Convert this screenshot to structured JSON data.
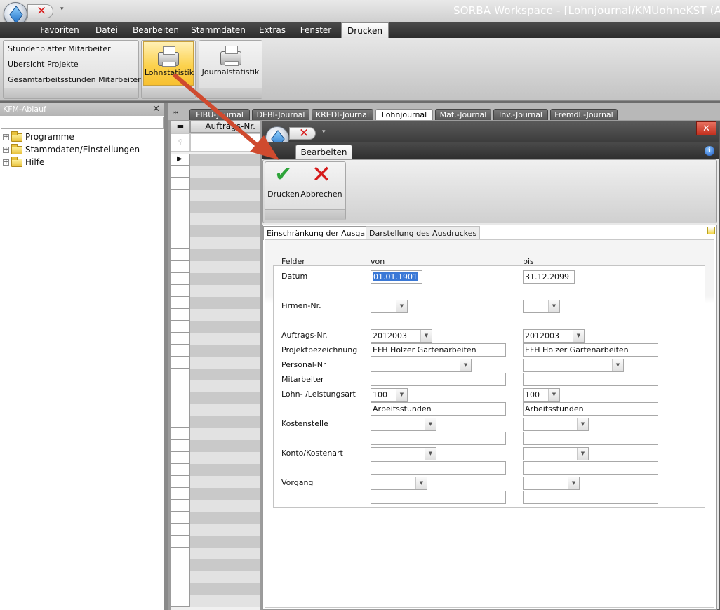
{
  "app": {
    "title": "SORBA Workspace - [Lohnjournal/KMUohneKST (Arbeits"
  },
  "menu": [
    "Favoriten",
    "Datei",
    "Bearbeiten",
    "Stammdaten",
    "Extras",
    "Fenster",
    "Drucken"
  ],
  "ribbon": {
    "links": [
      "Stundenblätter Mitarbeiter",
      "Übersicht Projekte",
      "Gesamtarbeitsstunden Mitarbeiter"
    ],
    "lohnstatistik_label": "Lohnstatistik",
    "journalstatistik_label": "Journalstatistik"
  },
  "left_panel": {
    "title": "KFM-Ablauf",
    "tree": [
      "Programme",
      "Stammdaten/Einstellungen",
      "Hilfe"
    ]
  },
  "journal_tabs": [
    "FIBU-Journal",
    "DEBI-Journal",
    "KREDI-Journal",
    "Lohnjournal",
    "Mat.-Journal",
    "Inv.-Journal",
    "Fremdl.-Journal"
  ],
  "grid": {
    "column_header": "Auftrags-Nr."
  },
  "dialog": {
    "tab": "Bearbeiten",
    "actions": {
      "print": "Drucken",
      "cancel": "Abbrechen"
    },
    "content_tabs": [
      "Einschränkung der Ausgabe",
      "Darstellung des Ausdruckes"
    ],
    "headers": {
      "felder": "Felder",
      "von": "von",
      "bis": "bis"
    },
    "fields": {
      "datum": {
        "label": "Datum",
        "von": "01.01.1901",
        "bis": "31.12.2099"
      },
      "firmen": {
        "label": "Firmen-Nr.",
        "von": "",
        "bis": ""
      },
      "auftrag": {
        "label": "Auftrags-Nr.",
        "von": "2012003",
        "bis": "2012003"
      },
      "projekt": {
        "label": "Projektbezeichnung",
        "von": "EFH Holzer Gartenarbeiten",
        "bis": "EFH Holzer Gartenarbeiten"
      },
      "personal": {
        "label": "Personal-Nr",
        "von": "",
        "bis": ""
      },
      "mitarbeiter": {
        "label": "Mitarbeiter",
        "von": "",
        "bis": ""
      },
      "lohnart": {
        "label": "Lohn- /Leistungsart",
        "von": "100",
        "bis": "100"
      },
      "lohnart_text": {
        "von": "Arbeitsstunden",
        "bis": "Arbeitsstunden"
      },
      "kostenstelle": {
        "label": "Kostenstelle",
        "von": "",
        "bis": ""
      },
      "konto": {
        "label": "Konto/Kostenart",
        "von": "",
        "bis": ""
      },
      "vorgang": {
        "label": "Vorgang",
        "von": "",
        "bis": ""
      }
    }
  },
  "colors": {
    "accent_arrow": "#cf4a2e",
    "active_button": "#fcd24e",
    "close_red": "#c2301e"
  }
}
